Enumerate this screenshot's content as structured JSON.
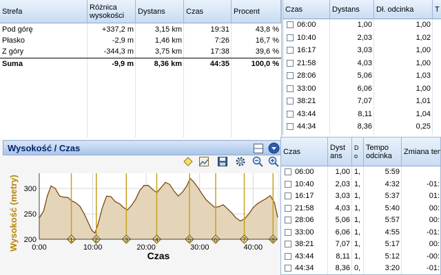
{
  "zones": {
    "headers": [
      "Strefa",
      "Różnica wysokości",
      "Dystans",
      "Czas",
      "Procent"
    ],
    "rows": [
      [
        "Pod górę",
        "+337,2 m",
        "3,15 km",
        "19:31",
        "43,8 %"
      ],
      [
        "Płasko",
        "-2,9 m",
        "1,46 km",
        "7:26",
        "16,7 %"
      ],
      [
        "Z góry",
        "-344,3 m",
        "3,75 km",
        "17:38",
        "39,6 %"
      ]
    ],
    "total": [
      "Suma",
      "-9,9 m",
      "8,36 km",
      "44:35",
      "100,0 %"
    ]
  },
  "splits_top": {
    "headers": [
      "Czas",
      "Dystans",
      "Dł. odcinka",
      "T"
    ],
    "rows": [
      [
        "06:00",
        "1,00",
        "1,00"
      ],
      [
        "10:40",
        "2,03",
        "1,02"
      ],
      [
        "16:17",
        "3,03",
        "1,00"
      ],
      [
        "21:58",
        "4,03",
        "1,00"
      ],
      [
        "28:06",
        "5,06",
        "1,03"
      ],
      [
        "33:00",
        "6,06",
        "1,00"
      ],
      [
        "38:21",
        "7,07",
        "1,01"
      ],
      [
        "43:44",
        "8,11",
        "1,04"
      ],
      [
        "44:34",
        "8,36",
        "0,25"
      ]
    ]
  },
  "splits_bottom": {
    "headers": [
      "Czas",
      "Dyst ans",
      "D o",
      "Tempo odcinka",
      "Zmiana temp"
    ],
    "rows": [
      [
        "06:00",
        "1,00",
        "1,",
        "5:59",
        ""
      ],
      [
        "10:40",
        "2,03",
        "1,",
        "4:32",
        "-01:"
      ],
      [
        "16:17",
        "3,03",
        "1,",
        "5:37",
        "01:"
      ],
      [
        "21:58",
        "4,03",
        "1,",
        "5:40",
        "00:"
      ],
      [
        "28:06",
        "5,06",
        "1,",
        "5:57",
        "00:"
      ],
      [
        "33:00",
        "6,06",
        "1,",
        "4:55",
        "-01:"
      ],
      [
        "38:21",
        "7,07",
        "1,",
        "5:17",
        "00:"
      ],
      [
        "43:44",
        "8,11",
        "1,",
        "5:12",
        "-00:"
      ],
      [
        "44:34",
        "8,36",
        "0,",
        "3:20",
        "-01:"
      ]
    ]
  },
  "chart_panel": {
    "title": "Wysokość / Czas",
    "icons": [
      "grid-toggle-icon",
      "dropdown-circle-icon",
      "diamond-marker-icon",
      "chart-image-icon",
      "save-disk-icon",
      "gear-icon",
      "zoom-out-icon",
      "zoom-in-icon"
    ]
  },
  "chart_data": {
    "type": "area",
    "title": "Wysokość / Czas",
    "xlabel": "Czas",
    "ylabel": "Wysokość (metry)",
    "xlim": [
      0,
      44.6
    ],
    "ylim": [
      200,
      330
    ],
    "xticks": [
      0,
      10,
      20,
      30,
      40
    ],
    "xtick_labels": [
      "0:00",
      "10:00",
      "20:00",
      "30:00",
      "40:00"
    ],
    "yticks": [
      200,
      250,
      300
    ],
    "ytick_labels": [
      "200",
      "250",
      "300"
    ],
    "grid": true,
    "colors": {
      "fill": "#e4d5b9",
      "line": "#7a4a12",
      "marker_line": "#c8a020",
      "marker_fill": "#f3e3a0"
    },
    "x": [
      0,
      0.8,
      1.5,
      2.2,
      3,
      3.8,
      4.6,
      5.4,
      6,
      6.8,
      7.6,
      8.4,
      9.2,
      9.8,
      10.4,
      11,
      11.8,
      12.6,
      13.4,
      14.2,
      15,
      15.8,
      16.5,
      17.2,
      18,
      18.8,
      19.6,
      20.4,
      21.2,
      22,
      22.8,
      23.6,
      24.4,
      25.2,
      26,
      26.8,
      27.6,
      28.2,
      28.8,
      29.6,
      30.4,
      31.2,
      32,
      32.8,
      33.6,
      34.4,
      35.2,
      36,
      36.8,
      37.6,
      38.4,
      39.2,
      40,
      40.8,
      41.6,
      42.4,
      43.2,
      44,
      44.6
    ],
    "y": [
      242,
      255,
      285,
      305,
      300,
      285,
      283,
      282,
      276,
      272,
      265,
      250,
      232,
      218,
      212,
      230,
      262,
      285,
      284,
      274,
      270,
      262,
      258,
      266,
      278,
      296,
      306,
      306,
      298,
      292,
      302,
      312,
      308,
      295,
      285,
      293,
      305,
      320,
      314,
      303,
      290,
      278,
      270,
      263,
      264,
      268,
      260,
      252,
      242,
      236,
      240,
      250,
      262,
      270,
      275,
      280,
      286,
      272,
      243
    ],
    "markers": [
      {
        "label": "1",
        "x": 6.0
      },
      {
        "label": "2",
        "x": 10.67
      },
      {
        "label": "3",
        "x": 16.28
      },
      {
        "label": "4",
        "x": 21.97
      },
      {
        "label": "5",
        "x": 28.1
      },
      {
        "label": "6",
        "x": 33.0
      },
      {
        "label": "7",
        "x": 38.35
      },
      {
        "label": "8",
        "x": 43.73
      }
    ]
  }
}
